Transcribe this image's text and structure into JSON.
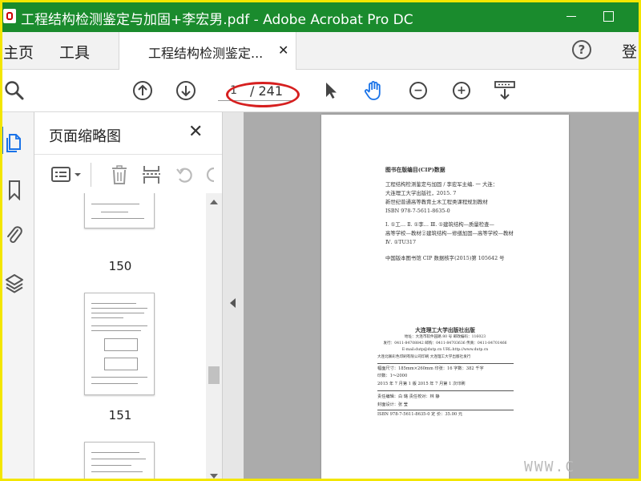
{
  "window": {
    "title": "工程结构检测鉴定与加固+李宏男.pdf - Adobe Acrobat Pro DC"
  },
  "tabs": {
    "home": "主页",
    "tools": "工具",
    "document": "工程结构检测鉴定...",
    "close": "✕",
    "signin": "登"
  },
  "toolbar": {
    "current_page": "1",
    "total_pages": "/ 241"
  },
  "thumbnail_panel": {
    "title": "页面缩略图",
    "close": "✕",
    "pages": [
      "150",
      "151"
    ]
  },
  "document_page": {
    "cip_heading": "图书在版编目(CIP)数据",
    "lines": [
      "工程结构检测鉴定与加固 / 李宏军主编. 一 大连：",
      "大连理工大学出版社，2015. 7",
      "新世纪普通高等教育土木工程类课程规划教材",
      "ISBN 978-7-5611-8635-0",
      "Ⅰ. ①工… Ⅱ. ①李… Ⅲ. ①建筑结构—质量检查—",
      "高等学校—教材②建筑结构—修缮加固—高等学校—教材",
      "Ⅳ. ①TU317",
      "中国版本图书馆 CIP 数据核字(2015)第 105642 号"
    ],
    "publisher": "大连理工大学出版社出版",
    "address_lines": [
      "地址：大连市软件园路 80 号    邮政编码：116023",
      "发行：0411-84708842   邮购：0411-84703636   传真：0411-84701466",
      "E-mail:dutp@dutp.cn   URL:http://www.dutp.cn",
      "大连北联彩色印刷有限公司印刷         大连理工大学出版社发行"
    ],
    "spec_lines": [
      "幅面尺寸：185mm×260mm      印张：16         字数：382 千字",
      "                          印数：1～2000",
      "2015 年 7 月第 1 版             2015 年 7 月第 1 次印刷"
    ],
    "editor_lines": [
      "责任编辑：白  璐                          责任校对：林  静",
      "                    封面设计：张  莹"
    ],
    "isbn_price": "ISBN 978-7-5611-8635-0                      定  价：35.00 元"
  },
  "watermark": "WWW.C"
}
